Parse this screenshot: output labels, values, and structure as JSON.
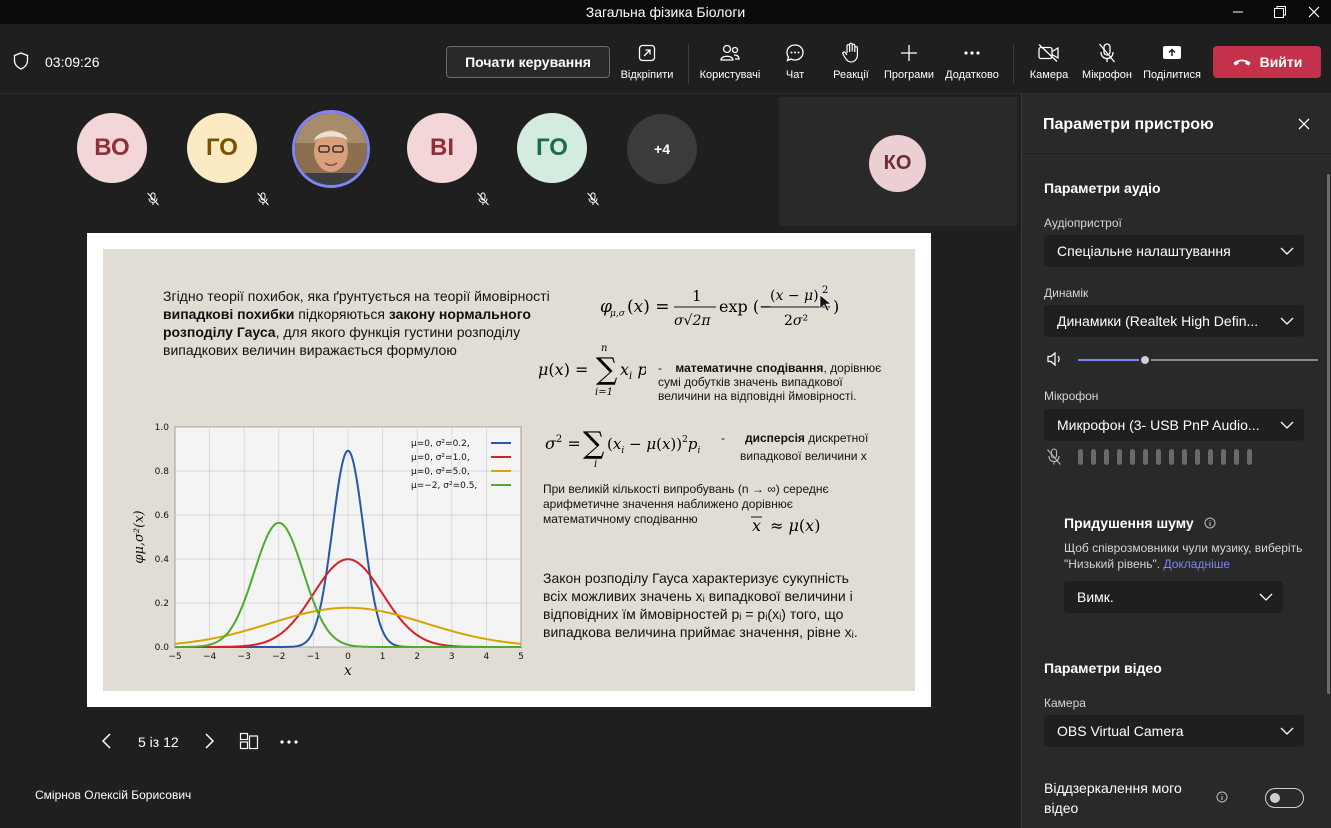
{
  "window": {
    "title": "Загальна фізика Біологи"
  },
  "toolbar": {
    "timer": "03:09:26",
    "control_label": "Почати керування",
    "items": {
      "popout": "Відкріпити",
      "people": "Користувачі",
      "chat": "Чат",
      "react": "Реакції",
      "apps": "Програми",
      "more": "Додатково",
      "camera": "Камера",
      "mic": "Мікрофон",
      "share": "Поділитися"
    },
    "leave_label": "Вийти"
  },
  "participants": [
    {
      "initials": "ВО",
      "bg": "#f3d6d8",
      "fg": "#8f2f38"
    },
    {
      "initials": "ГО",
      "bg": "#fbeac2",
      "fg": "#7a5200"
    },
    {
      "initials": "",
      "bg": "#8b7a65",
      "fg": "#ffffff"
    },
    {
      "initials": "ВІ",
      "bg": "#f3d6d8",
      "fg": "#8f2f38"
    },
    {
      "initials": "ГО",
      "bg": "#d4ecdf",
      "fg": "#1f6b45"
    }
  ],
  "participants_more": "+4",
  "self_view": {
    "initials": "КО"
  },
  "slide": {
    "para1_pre": "Згідно теорії похибок, яка ґрунтується на теорії ймовірності",
    "para1_b1": "випадкові похибки",
    "para1_mid": " підкоряються ",
    "para1_b2": "закону нормального",
    "para1_b3": "розподілу Гауса",
    "para1_post": ", для якого функція густини розподілу",
    "para1_end": "випадкових величин виражається формулою",
    "expect_bold": "математичне сподівання",
    "expect_rest": ", дорівнює",
    "expect_l2": "сумі добутків значень випадкової",
    "expect_l3": "величини на відповідні ймовірності.",
    "disp_bold": "дисперсія",
    "disp_rest": " дискретної",
    "disp_l2": "випадкової величини  x",
    "limit_l1": "При великій кількості випробувань (n → ∞)  середнє",
    "limit_l2": "арифметичне значення наближено дорівнює",
    "limit_l3": "математичному сподіванню",
    "gauss_l1": "Закон розподілу Гауса характеризує сукупність",
    "gauss_l2": "всіх можливих значень xᵢ випадкової величини і",
    "gauss_l3": "відповідних їм ймовірностей pᵢ = pᵢ(xᵢ) того, що",
    "gauss_l4": "випадкова величина приймає значення, рівне xᵢ."
  },
  "chart_data": {
    "type": "line",
    "xlabel": "x",
    "ylabel": "φμ,σ²(x)",
    "xlim": [
      -5,
      5
    ],
    "ylim": [
      0,
      1.0
    ],
    "xticks": [
      -5,
      -4,
      -3,
      -2,
      -1,
      0,
      1,
      2,
      3,
      4,
      5
    ],
    "yticks": [
      0.0,
      0.2,
      0.4,
      0.6,
      0.8,
      1.0
    ],
    "grid": true,
    "legend_position": "top-right",
    "series": [
      {
        "name": "μ=0,   σ²=0.2,",
        "mu": 0,
        "sigma2": 0.2,
        "color": "#2b56a3"
      },
      {
        "name": "μ=0,   σ²=1.0,",
        "mu": 0,
        "sigma2": 1.0,
        "color": "#d42026"
      },
      {
        "name": "μ=0,   σ²=5.0,",
        "mu": 0,
        "sigma2": 5.0,
        "color": "#d9a300"
      },
      {
        "name": "μ=−2,  σ²=0.5,",
        "mu": -2,
        "sigma2": 0.5,
        "color": "#4cab30"
      }
    ]
  },
  "slide_nav": {
    "page": "5 із 12"
  },
  "presenter": "Смірнов Олексій Борисович",
  "panel": {
    "title": "Параметри пристрою",
    "audio_title": "Параметри аудіо",
    "audio_device_label": "Аудіопристрої",
    "audio_device_value": "Спеціальне налаштування",
    "speaker_label": "Динамік",
    "speaker_value": "Динамики (Realtek High Defin...",
    "speaker_volume": 0.28,
    "mic_label": "Мікрофон",
    "mic_value": "Микрофон (3- USB PnP Audio...",
    "noise_title": "Придушення шуму",
    "noise_desc": "Щоб співрозмовники чули музику, виберіть \"Низький рівень\".",
    "noise_link": "Докладніше",
    "noise_value": "Вимк.",
    "video_title": "Параметри відео",
    "camera_label": "Камера",
    "camera_value": "OBS Virtual Camera",
    "mirror_label": "Віддзеркалення мого відео",
    "mirror_on": false
  },
  "colors": {
    "accent": "#7f85f5",
    "leave": "#c4314b",
    "bg": "#1f1f1f",
    "panel": "#292929"
  }
}
